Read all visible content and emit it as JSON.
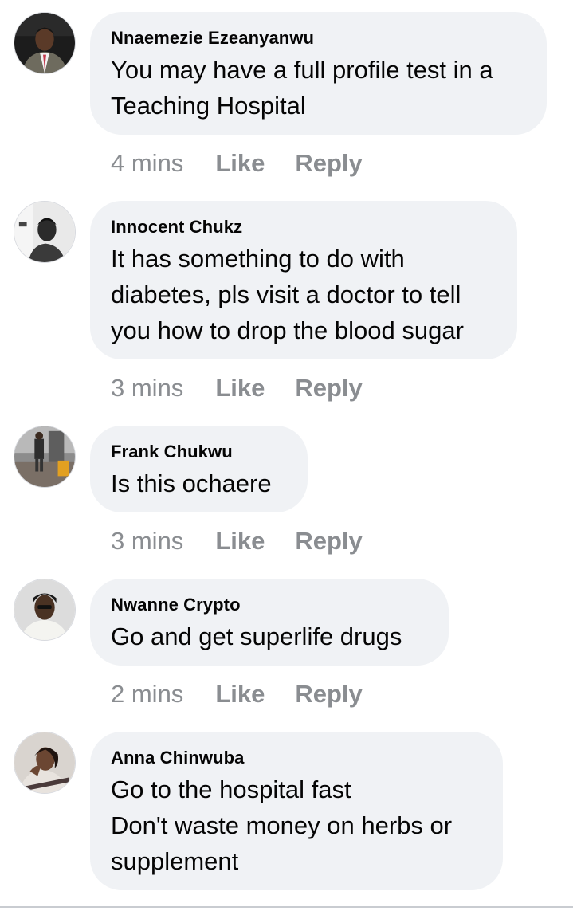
{
  "comments": [
    {
      "author": "Nnaemezie Ezeanyanwu",
      "text": "You may have a full profile test in a\nTeaching Hospital",
      "time": "4 mins",
      "like_label": "Like",
      "reply_label": "Reply"
    },
    {
      "author": "Innocent Chukz",
      "text": "It has something to do with\ndiabetes, pls visit a doctor to tell\nyou how to drop the blood sugar",
      "time": "3 mins",
      "like_label": "Like",
      "reply_label": "Reply"
    },
    {
      "author": "Frank Chukwu",
      "text": "Is this ochaere",
      "time": "3 mins",
      "like_label": "Like",
      "reply_label": "Reply"
    },
    {
      "author": "Nwanne Crypto",
      "text": "Go and get superlife drugs",
      "time": "2 mins",
      "like_label": "Like",
      "reply_label": "Reply"
    },
    {
      "author": "Anna Chinwuba",
      "text": "Go to the hospital fast\nDon't waste money on herbs or\nsupplement",
      "time": "",
      "like_label": "",
      "reply_label": ""
    }
  ],
  "colors": {
    "bubble_bg": "#f0f2f5",
    "text": "#050505",
    "meta": "#8a8d91"
  }
}
